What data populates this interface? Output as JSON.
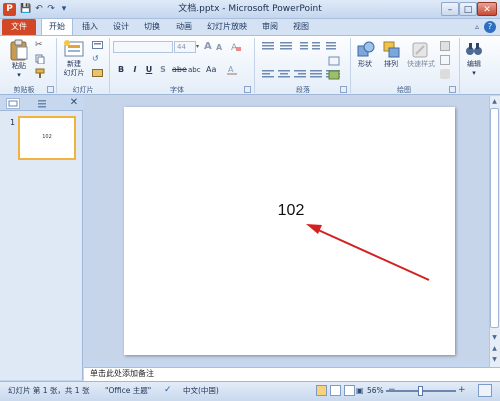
{
  "window": {
    "title": "文档.pptx - Microsoft PowerPoint",
    "app_icon": "P"
  },
  "tabs": [
    {
      "label": "文件",
      "active": false
    },
    {
      "label": "开始",
      "active": true
    },
    {
      "label": "插入"
    },
    {
      "label": "设计"
    },
    {
      "label": "切换"
    },
    {
      "label": "动画"
    },
    {
      "label": "幻灯片放映"
    },
    {
      "label": "审阅"
    },
    {
      "label": "视图"
    }
  ],
  "ribbon": {
    "clipboard": {
      "paste": "粘贴",
      "group": "剪贴板"
    },
    "slides": {
      "new_slide_1": "新建",
      "new_slide_2": "幻灯片",
      "group": "幻灯片"
    },
    "font": {
      "size": "44",
      "group": "字体",
      "bold": "B",
      "italic": "I",
      "underline": "U",
      "strike": "S",
      "spacing": "abc",
      "aa": "Aa",
      "grow": "A",
      "shrink": "A"
    },
    "paragraph": {
      "group": "段落"
    },
    "drawing": {
      "shapes": "形状",
      "arrange": "排列",
      "quick_styles": "快速样式",
      "group": "绘图"
    },
    "editing": {
      "label": "编辑"
    }
  },
  "slide_panel": {
    "slide_number": "1",
    "thumb_text": "102"
  },
  "slide": {
    "text": "102"
  },
  "notes": {
    "placeholder": "单击此处添加备注"
  },
  "status": {
    "slide_info": "幻灯片 第 1 张，共 1 张",
    "theme": "\"Office 主题\"",
    "language": "中文(中国)",
    "zoom": "56%"
  },
  "colors": {
    "file_tab": "#d24726",
    "arrow": "#d32020",
    "thumb_border": "#f0b33f"
  }
}
